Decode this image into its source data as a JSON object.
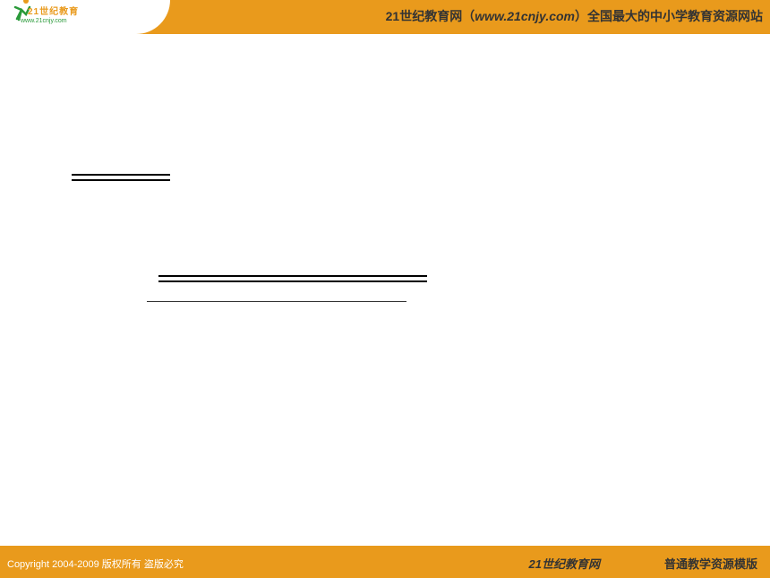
{
  "header": {
    "logo_text": "21世纪教育",
    "logo_sub": "www.21cnjy.com",
    "tagline_prefix": "21世纪教育网（",
    "tagline_url": "www.21cnjy.com",
    "tagline_suffix": "）全国最大的中小学教育资源网站"
  },
  "footer": {
    "copyright": "Copyright 2004-2009 版权所有 盗版必究",
    "brand": "21世纪教育网",
    "template_name": "普通教学资源模版"
  },
  "icons": {
    "runner": "runner-icon"
  }
}
